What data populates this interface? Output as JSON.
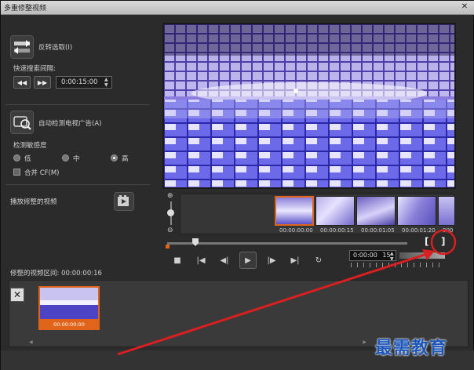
{
  "window": {
    "title": "多重修整视频",
    "close_label": "✕"
  },
  "left_panel": {
    "reverse_selection": "反转选取(I)",
    "fast_search_interval_label": "快速搜索间隔:",
    "interval_value": "0:00:15:00",
    "auto_detect_ads": "自动检测电视广告(A)",
    "sensitivity_label": "检测敏感度",
    "sensitivity_options": [
      "低",
      "中",
      "高"
    ],
    "sensitivity_selected": "高",
    "merge_cf": "合并 CF(M)",
    "play_trimmed": "播放修整的视频"
  },
  "filmstrip": {
    "timecodes": [
      "00:00:00:00",
      "00:00:00:15",
      "00:00:01:05",
      "00:00:01:20",
      "000"
    ]
  },
  "scrub": {
    "mark_in": "[",
    "mark_out": "]"
  },
  "transport": {
    "buttons": [
      "stop",
      "home",
      "prev-frame",
      "play",
      "next-frame",
      "end",
      "repeat"
    ],
    "timecode": "0:00:00",
    "timecode_frames": "15"
  },
  "trimmed_duration": "修整的视频区间: 00:00:00:16",
  "bin": {
    "delete_label": "✕",
    "clip_label": "00:00:00:00"
  },
  "watermark": "最需教育",
  "colors": {
    "accent": "#e0641a",
    "annotation": "#d91f1f",
    "watermark": "#1c56b8"
  }
}
